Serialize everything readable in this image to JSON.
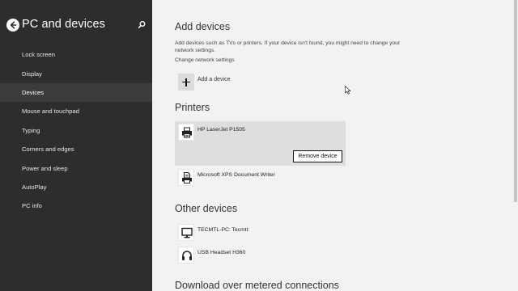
{
  "sidebar": {
    "title": "PC and devices",
    "back_icon": "back-arrow-icon",
    "search_icon": "search-icon",
    "items": [
      {
        "label": "Lock screen"
      },
      {
        "label": "Display"
      },
      {
        "label": "Devices",
        "active": true
      },
      {
        "label": "Mouse and touchpad"
      },
      {
        "label": "Typing"
      },
      {
        "label": "Corners and edges"
      },
      {
        "label": "Power and sleep"
      },
      {
        "label": "AutoPlay"
      },
      {
        "label": "PC info"
      }
    ]
  },
  "add_devices": {
    "heading": "Add devices",
    "description": "Add devices such as TVs or printers. If your device isn't found, you might need to change your network settings.",
    "change_network_link": "Change network settings",
    "add_button_label": "Add a device",
    "add_icon": "plus-icon"
  },
  "printers": {
    "heading": "Printers",
    "items": [
      {
        "name": "HP LaserJet P1505",
        "icon": "printer-icon",
        "selected": true
      },
      {
        "name": "Microsoft XPS Document Writer",
        "icon": "document-printer-icon"
      }
    ],
    "remove_button_label": "Remove device"
  },
  "other_devices": {
    "heading": "Other devices",
    "items": [
      {
        "name": "TECMTL-PC: Tecmtl:",
        "icon": "monitor-icon"
      },
      {
        "name": "USB Headset H360",
        "icon": "headset-icon"
      }
    ]
  },
  "download_metered": {
    "heading": "Download over metered connections"
  },
  "colors": {
    "sidebar_bg": "#2d2d2d",
    "sidebar_active_bg": "#3b3b3b",
    "content_bg": "#f2f2f2",
    "selected_item_bg": "#dedede"
  }
}
